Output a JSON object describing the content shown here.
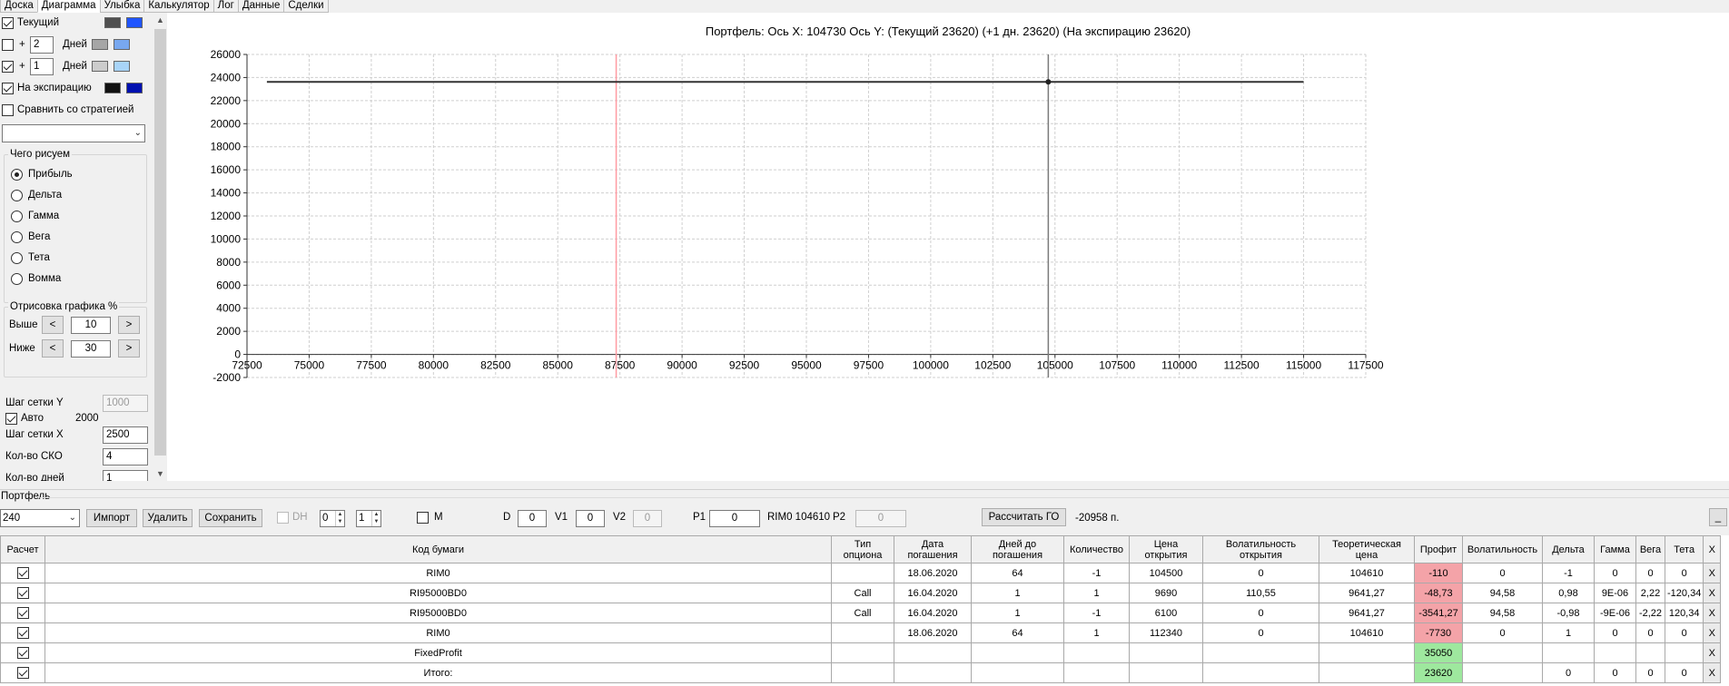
{
  "tabs": [
    "Доска",
    "Диаграмма",
    "Улыбка",
    "Калькулятор",
    "Лог",
    "Данные",
    "Сделки"
  ],
  "active_tab": 1,
  "left": {
    "current_label": "Текущий",
    "days_label": "Дней",
    "plus_label": "+",
    "plus1_value": "2",
    "plus2_value": "1",
    "expiry_label": "На экспирацию",
    "compare_label": "Сравнить со стратегией",
    "what_title": "Чего рисуем",
    "radios": [
      "Прибыль",
      "Дельта",
      "Гамма",
      "Вега",
      "Тета",
      "Вомма"
    ],
    "draw_title": "Отрисовка графика %",
    "above_label": "Выше",
    "above_value": "10",
    "below_label": "Ниже",
    "below_value": "30",
    "prev": "<",
    "next": ">",
    "gridY_label": "Шаг сетки Y",
    "gridY_value": "1000",
    "auto_label": "Авто",
    "auto_value": "2000",
    "gridX_label": "Шаг сетки X",
    "gridX_value": "2500",
    "sko_label": "Кол-во СКО",
    "sko_value": "4",
    "days_count_label": "Кол-во дней",
    "days_count_value": "1",
    "colors": {
      "current_a": "#505050",
      "current_b": "#2055ff",
      "plus1_a": "#a6a6a6",
      "plus1_b": "#78a8f0",
      "plus2_a": "#cccccc",
      "plus2_b": "#a8d4f8",
      "expiry_a": "#111111",
      "expiry_b": "#0010b0"
    }
  },
  "chart_data": {
    "type": "line",
    "title": "Портфель: Ось X: 104730 Ось Y:  (Текущий 23620)  (+1 дн. 23620)  (На экспирацию 23620)",
    "xlim": [
      72500,
      117500
    ],
    "ylim": [
      -2000,
      26000
    ],
    "xticks": [
      72500,
      75000,
      77500,
      80000,
      82500,
      85000,
      87500,
      90000,
      92500,
      95000,
      97500,
      100000,
      102500,
      105000,
      107500,
      110000,
      112500,
      115000,
      117500
    ],
    "yticks": [
      -2000,
      0,
      2000,
      4000,
      6000,
      8000,
      10000,
      12000,
      14000,
      16000,
      18000,
      20000,
      22000,
      24000,
      26000
    ],
    "grid": true,
    "series": [
      {
        "values": [
          {
            "x": 73300,
            "y": 23620
          },
          {
            "x": 115000,
            "y": 23620
          }
        ]
      }
    ],
    "marker": {
      "x": 104730,
      "y": 23620
    },
    "vlines": [
      {
        "x": 87350,
        "color": "#ff9aa2"
      },
      {
        "x": 104730,
        "color": "#7a7a7a"
      }
    ]
  },
  "portfolio": {
    "title": "Портфель",
    "select_value": "240",
    "import": "Импорт",
    "delete": "Удалить",
    "save": "Сохранить",
    "dh_label": "DH",
    "spin1": "0",
    "spin2": "1",
    "m_label": "M",
    "d_label": "D",
    "d_value": "0",
    "v1_label": "V1",
    "v1_value": "0",
    "v2_label": "V2",
    "v2_value": "0",
    "p1_label": "P1",
    "p1_value": "0",
    "rim_label": "RIM0 104610",
    "p2_label": "P2",
    "p2_value": "0",
    "calc_button": "Рассчитать ГО",
    "go_value": "-20958 п.",
    "min_button": "_"
  },
  "grid": {
    "columns": [
      "Расчет",
      "Код бумаги",
      "Тип опциона",
      "Дата погашения",
      "Дней до погашения",
      "Количество",
      "Цена открытия",
      "Волатильность открытия",
      "Теоретическая цена",
      "Профит",
      "Волатильность",
      "Дельта",
      "Гамма",
      "Вега",
      "Тета",
      "X"
    ],
    "rows": [
      [
        "",
        "RIM0",
        "",
        "18.06.2020",
        "64",
        "-1",
        "104500",
        "0",
        "104610",
        "-110",
        "0",
        "-1",
        "0",
        "0",
        "0",
        "X"
      ],
      [
        "",
        "RI95000BD0",
        "Call",
        "16.04.2020",
        "1",
        "1",
        "9690",
        "110,55",
        "9641,27",
        "-48,73",
        "94,58",
        "0,98",
        "9E-06",
        "2,22",
        "-120,34",
        "X"
      ],
      [
        "",
        "RI95000BD0",
        "Call",
        "16.04.2020",
        "1",
        "-1",
        "6100",
        "0",
        "9641,27",
        "-3541,27",
        "94,58",
        "-0,98",
        "-9E-06",
        "-2,22",
        "120,34",
        "X"
      ],
      [
        "",
        "RIM0",
        "",
        "18.06.2020",
        "64",
        "1",
        "112340",
        "0",
        "104610",
        "-7730",
        "0",
        "1",
        "0",
        "0",
        "0",
        "X"
      ],
      [
        "",
        "FixedProfit",
        "",
        "",
        "",
        "",
        "",
        "",
        "",
        "35050",
        "",
        "",
        "",
        "",
        "",
        "X"
      ],
      [
        "",
        "Итого:",
        "",
        "",
        "",
        "",
        "",
        "",
        "",
        "23620",
        "",
        "0",
        "0",
        "0",
        "0",
        "X"
      ]
    ],
    "profit_colors": {
      "neg": "#f4a3a8",
      "pos": "#9ee89e"
    }
  }
}
